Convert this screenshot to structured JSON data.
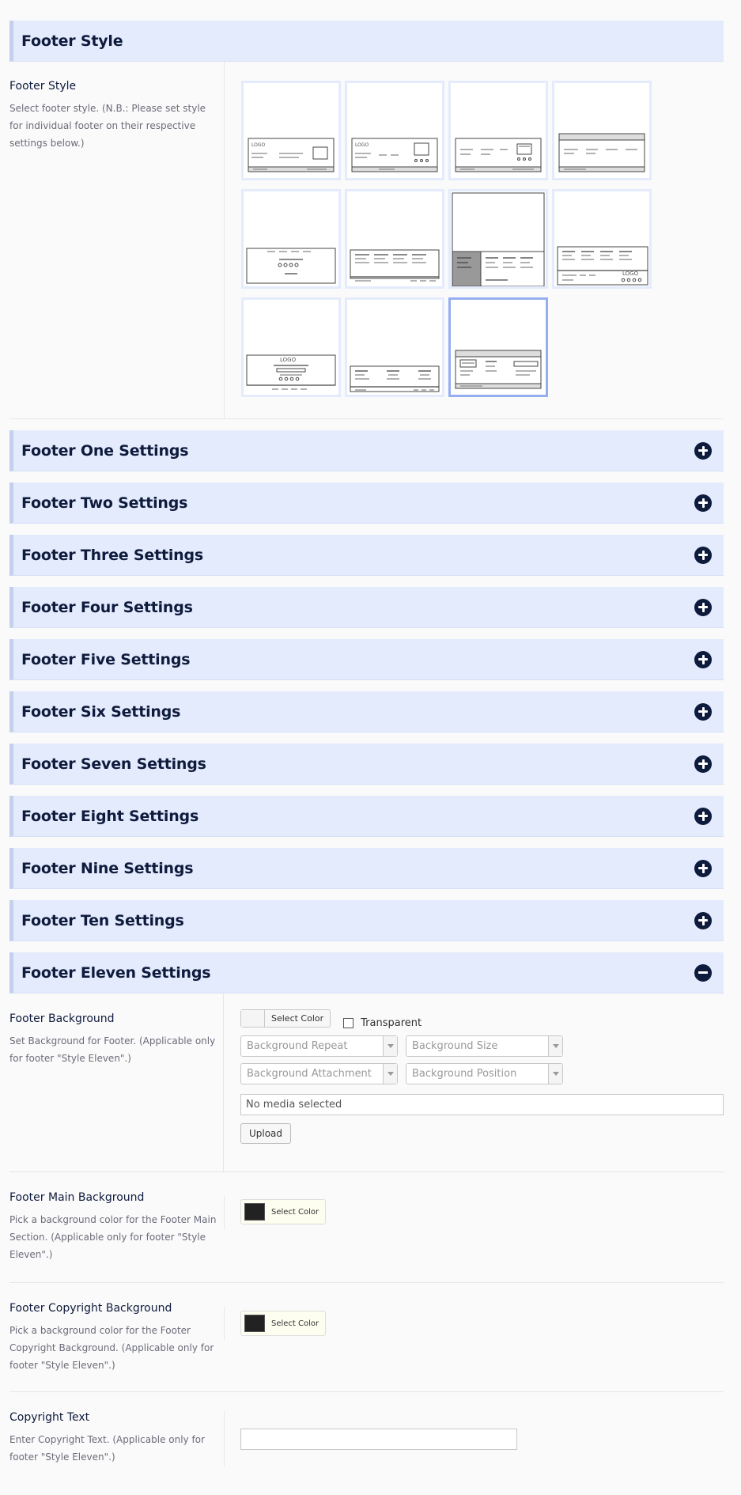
{
  "footer_style": {
    "section_title": "Footer Style",
    "field_title": "Footer Style",
    "field_desc": "Select footer style. (N.B.: Please set style for individual footer on their respective settings below.)",
    "thumb_logo_text": "LOGO",
    "selected_index": 10
  },
  "accordion": [
    {
      "label": "Footer One Settings",
      "expanded": false
    },
    {
      "label": "Footer Two Settings",
      "expanded": false
    },
    {
      "label": "Footer Three Settings",
      "expanded": false
    },
    {
      "label": "Footer Four Settings",
      "expanded": false
    },
    {
      "label": "Footer Five Settings",
      "expanded": false
    },
    {
      "label": "Footer Six Settings",
      "expanded": false
    },
    {
      "label": "Footer Seven Settings",
      "expanded": false
    },
    {
      "label": "Footer Eight Settings",
      "expanded": false
    },
    {
      "label": "Footer Nine Settings",
      "expanded": false
    },
    {
      "label": "Footer Ten Settings",
      "expanded": false
    },
    {
      "label": "Footer Eleven Settings",
      "expanded": true
    }
  ],
  "eleven": {
    "background": {
      "title": "Footer Background",
      "desc": "Set Background for Footer. (Applicable only for footer \"Style Eleven\".)",
      "select_color": "Select Color",
      "transparent_label": "Transparent",
      "repeat_placeholder": "Background Repeat",
      "size_placeholder": "Background Size",
      "attachment_placeholder": "Background Attachment",
      "position_placeholder": "Background Position",
      "media_text": "No media selected",
      "upload_label": "Upload"
    },
    "main_background": {
      "title": "Footer Main Background",
      "desc": "Pick a background color for the Footer Main Section. (Applicable only for footer \"Style Eleven\".)",
      "select_color": "Select Color",
      "color": "#222222"
    },
    "copyright_background": {
      "title": "Footer Copyright Background",
      "desc": "Pick a background color for the Footer Copyright Background. (Applicable only for footer \"Style Eleven\".)",
      "select_color": "Select Color",
      "color": "#222222"
    },
    "copyright_text": {
      "title": "Copyright Text",
      "desc": "Enter Copyright Text. (Applicable only for footer \"Style Eleven\".)",
      "value": ""
    }
  },
  "colors": {
    "header_bg": "#e3ebfc",
    "header_text": "#0f1b3d",
    "selected_border": "#94aef0"
  }
}
